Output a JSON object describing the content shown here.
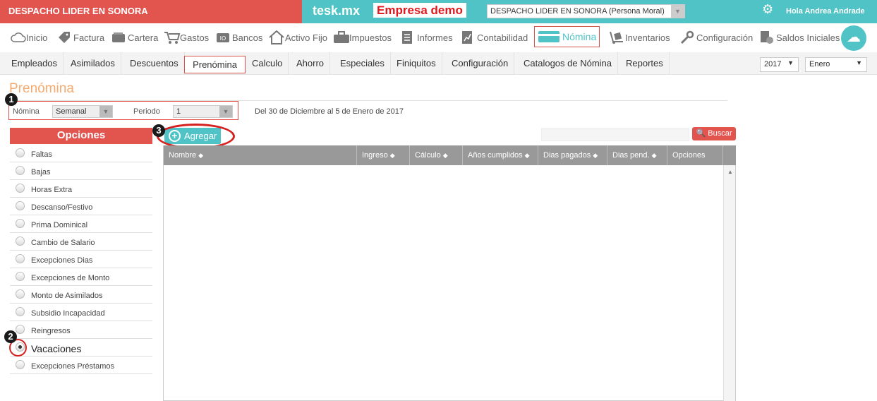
{
  "topbar": {
    "company_name": "DESPACHO LIDER EN SONORA",
    "brand": "tesk.mx",
    "demo_label": "Empresa demo",
    "company_select": "DESPACHO LIDER EN SONORA  (Persona Moral)",
    "greeting": "Hola Andrea Andrade",
    "accent": "#4fc3c5",
    "brand_red": "#e2554f"
  },
  "modules": [
    {
      "label": "Inicio",
      "icon": "cloud-icon"
    },
    {
      "label": "Factura",
      "icon": "tag-icon"
    },
    {
      "label": "Cartera",
      "icon": "wallet-icon"
    },
    {
      "label": "Gastos",
      "icon": "cart-icon"
    },
    {
      "label": "Bancos",
      "icon": "bank-icon"
    },
    {
      "label": "Activo Fijo",
      "icon": "house-icon"
    },
    {
      "label": "Impuestos",
      "icon": "briefcase-icon"
    },
    {
      "label": "Informes",
      "icon": "document-icon"
    },
    {
      "label": "Contabilidad",
      "icon": "chart-doc-icon"
    },
    {
      "label": "Nómina",
      "icon": "card-icon",
      "active": true
    },
    {
      "label": "Inventarios",
      "icon": "dolly-icon"
    },
    {
      "label": "Configuración",
      "icon": "wrench-icon"
    },
    {
      "label": "Saldos Iniciales",
      "icon": "coins-doc-icon"
    }
  ],
  "subnav": {
    "items": [
      "Empleados",
      "Asimilados",
      "Descuentos",
      "Prenómina",
      "Calculo",
      "Ahorro",
      "Especiales",
      "Finiquitos",
      "Configuración",
      "Catalogos de Nómina",
      "Reportes"
    ],
    "active": "Prenómina",
    "year": "2017",
    "month": "Enero"
  },
  "page": {
    "title": "Prenómina",
    "nomina_label": "Nómina",
    "nomina_value": "Semanal",
    "periodo_label": "Periodo",
    "periodo_value": "1",
    "date_range": "Del 30 de Diciembre al 5 de Enero de 2017"
  },
  "annotations": [
    "1",
    "2",
    "3"
  ],
  "options": {
    "header": "Opciones",
    "items": [
      "Faltas",
      "Bajas",
      "Horas Extra",
      "Descanso/Festivo",
      "Prima Dominical",
      "Cambio de Salario",
      "Excepciones Dias",
      "Excepciones de Monto",
      "Monto de Asimilados",
      "Subsidio Incapacidad",
      "Reingresos",
      "Vacaciones",
      "Excepciones Préstamos"
    ],
    "selected": "Vacaciones"
  },
  "toolbar": {
    "add_label": "Agregar",
    "search_value": "",
    "search_label": "Buscar"
  },
  "table": {
    "columns": [
      "Nombre",
      "Ingreso",
      "Cálculo",
      "Años cumplidos",
      "Dias pagados",
      "Dias pend.",
      "Opciones"
    ],
    "rows": []
  }
}
